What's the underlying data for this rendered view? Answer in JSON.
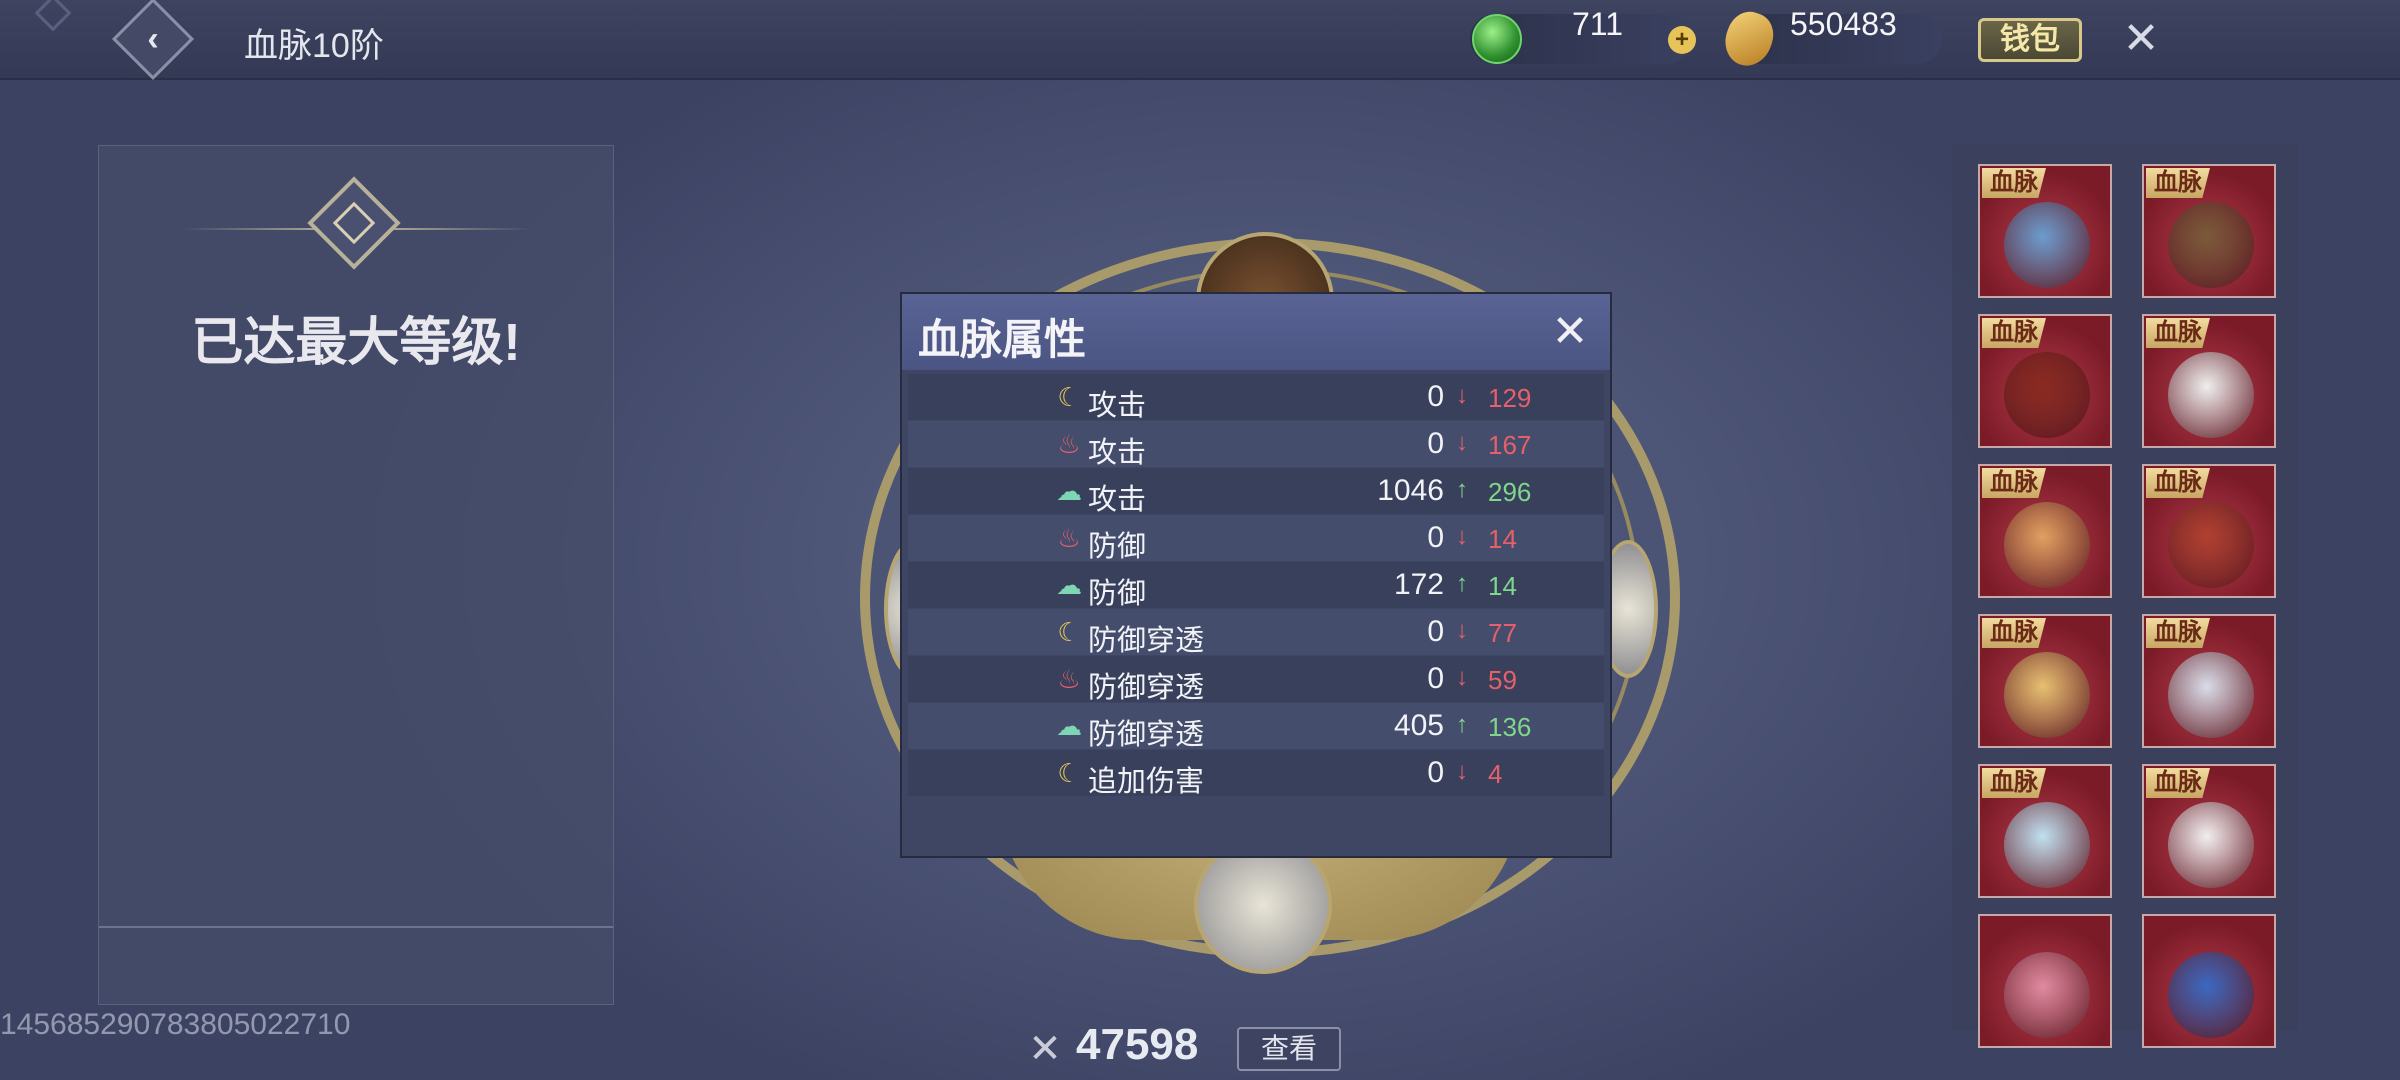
{
  "header": {
    "title": "血脉10阶",
    "jade_amount": "711",
    "gold_amount": "550483",
    "wallet_label": "钱包"
  },
  "left": {
    "max_level_text": "已达最大等级!"
  },
  "debug_id": "145685290783805022710",
  "bottom": {
    "power": "47598",
    "view_label": "查看"
  },
  "modal": {
    "title": "血脉属性",
    "rows": [
      {
        "icon": "moon-icon",
        "label": "攻击",
        "value": "0",
        "dir": "down",
        "delta": "129"
      },
      {
        "icon": "fire-icon",
        "label": "攻击",
        "value": "0",
        "dir": "down",
        "delta": "167"
      },
      {
        "icon": "cloud-icon",
        "label": "攻击",
        "value": "1046",
        "dir": "up",
        "delta": "296"
      },
      {
        "icon": "fire-icon",
        "label": "防御",
        "value": "0",
        "dir": "down",
        "delta": "14"
      },
      {
        "icon": "cloud-icon",
        "label": "防御",
        "value": "172",
        "dir": "up",
        "delta": "14"
      },
      {
        "icon": "moon-icon",
        "label": "防御穿透",
        "value": "0",
        "dir": "down",
        "delta": "77"
      },
      {
        "icon": "fire-icon",
        "label": "防御穿透",
        "value": "0",
        "dir": "down",
        "delta": "59"
      },
      {
        "icon": "cloud-icon",
        "label": "防御穿透",
        "value": "405",
        "dir": "up",
        "delta": "136"
      },
      {
        "icon": "moon-icon",
        "label": "追加伤害",
        "value": "0",
        "dir": "down",
        "delta": "4"
      }
    ]
  },
  "cards": [
    {
      "tag": "血脉",
      "art": "blue-dragon"
    },
    {
      "tag": "血脉",
      "art": "lion"
    },
    {
      "tag": "血脉",
      "art": "red-dragon"
    },
    {
      "tag": "血脉",
      "art": "panda"
    },
    {
      "tag": "血脉",
      "art": "fox-spirit"
    },
    {
      "tag": "血脉",
      "art": "fire-dragon"
    },
    {
      "tag": "血脉",
      "art": "golden-maiden"
    },
    {
      "tag": "血脉",
      "art": "white-wolf"
    },
    {
      "tag": "血脉",
      "art": "ice-maiden"
    },
    {
      "tag": "血脉",
      "art": "white-rabbit"
    },
    {
      "tag": "",
      "art": "lotus"
    },
    {
      "tag": "",
      "art": "blue-serpent"
    }
  ],
  "colors": {
    "up": "#7fd68c",
    "down": "#e5606a",
    "card_bg": "#9a2a38",
    "tag_bg": "#e8c98a"
  }
}
